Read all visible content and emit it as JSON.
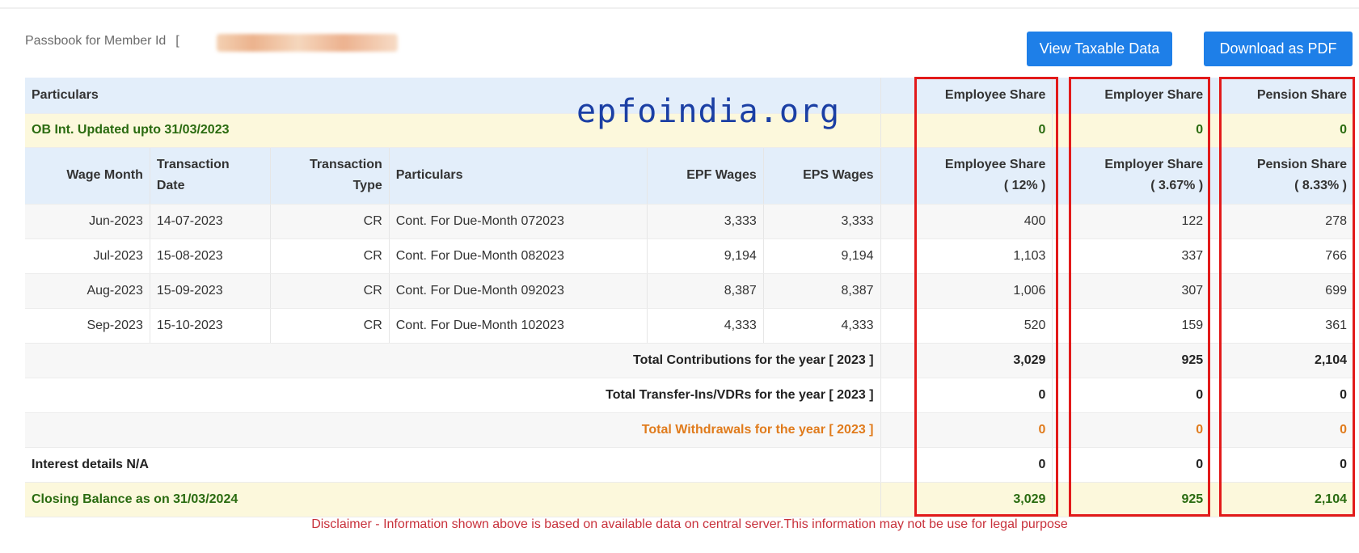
{
  "header": {
    "label": "Passbook for Member Id",
    "bracket": "["
  },
  "buttons": {
    "taxable": "View Taxable Data",
    "pdf": "Download as PDF"
  },
  "watermark": "epfoindia.org",
  "table": {
    "particulars_header": "Particulars",
    "share_headers": [
      "Employee Share",
      "Employer Share",
      "Pension Share"
    ],
    "ob_row": {
      "label": "OB Int. Updated upto 31/03/2023",
      "values": [
        "0",
        "0",
        "0"
      ]
    },
    "columns": {
      "wage_month": "Wage Month",
      "txn_date": [
        "Transaction",
        "Date"
      ],
      "txn_type": [
        "Transaction",
        "Type"
      ],
      "particulars": "Particulars",
      "epf_wages": "EPF Wages",
      "eps_wages": "EPS Wages",
      "employee": [
        "Employee Share",
        "( 12% )"
      ],
      "employer": [
        "Employer Share",
        "( 3.67% )"
      ],
      "pension": [
        "Pension Share",
        "( 8.33% )"
      ]
    },
    "rows": [
      {
        "month": "Jun-2023",
        "date": "14-07-2023",
        "type": "CR",
        "particulars": "Cont. For Due-Month 072023",
        "epf": "3,333",
        "eps": "3,333",
        "employee": "400",
        "employer": "122",
        "pension": "278"
      },
      {
        "month": "Jul-2023",
        "date": "15-08-2023",
        "type": "CR",
        "particulars": "Cont. For Due-Month 082023",
        "epf": "9,194",
        "eps": "9,194",
        "employee": "1,103",
        "employer": "337",
        "pension": "766"
      },
      {
        "month": "Aug-2023",
        "date": "15-09-2023",
        "type": "CR",
        "particulars": "Cont. For Due-Month 092023",
        "epf": "8,387",
        "eps": "8,387",
        "employee": "1,006",
        "employer": "307",
        "pension": "699"
      },
      {
        "month": "Sep-2023",
        "date": "15-10-2023",
        "type": "CR",
        "particulars": "Cont. For Due-Month 102023",
        "epf": "4,333",
        "eps": "4,333",
        "employee": "520",
        "employer": "159",
        "pension": "361"
      }
    ],
    "totals": {
      "contributions": {
        "label": "Total Contributions for the year [ 2023 ]",
        "values": [
          "3,029",
          "925",
          "2,104"
        ]
      },
      "transfers": {
        "label": "Total Transfer-Ins/VDRs for the year [ 2023 ]",
        "values": [
          "0",
          "0",
          "0"
        ]
      },
      "withdrawals": {
        "label": "Total Withdrawals for the year [ 2023 ]",
        "values": [
          "0",
          "0",
          "0"
        ]
      },
      "interest": {
        "label": "Interest details N/A",
        "values": [
          "0",
          "0",
          "0"
        ]
      },
      "closing": {
        "label": "Closing Balance as on 31/03/2024",
        "values": [
          "3,029",
          "925",
          "2,104"
        ]
      }
    }
  },
  "disclaimer": "Disclaimer - Information shown above is based on available data on central server.This information may not be use for legal purpose",
  "colors": {
    "button_blue": "#1e7fe8",
    "highlight_red": "#e21a1a",
    "header_bg": "#e3eefa",
    "ob_bg": "#fcf8dc",
    "green_text": "#2a6b10",
    "withdrawal_orange": "#e07b1c",
    "disclaimer_red": "#c8313b"
  }
}
